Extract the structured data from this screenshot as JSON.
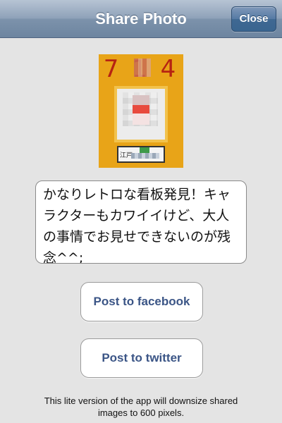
{
  "navbar": {
    "title": "Share Photo",
    "close_label": "Close"
  },
  "photo": {
    "sign_number": "7 1 4",
    "plate_label": "江戸"
  },
  "message": {
    "text": "かなりレトロな看板発見！キャラクターもカワイイけど、大人の事情でお見せできないのが残念^^;"
  },
  "buttons": {
    "facebook_label": "Post to facebook",
    "twitter_label": "Post to twitter"
  },
  "footer": {
    "note": "This lite version of the app will downsize shared images to 600 pixels."
  },
  "colors": {
    "navbar": "#8fa2b9",
    "button_text": "#3b5586",
    "background": "#e4e4e4"
  }
}
